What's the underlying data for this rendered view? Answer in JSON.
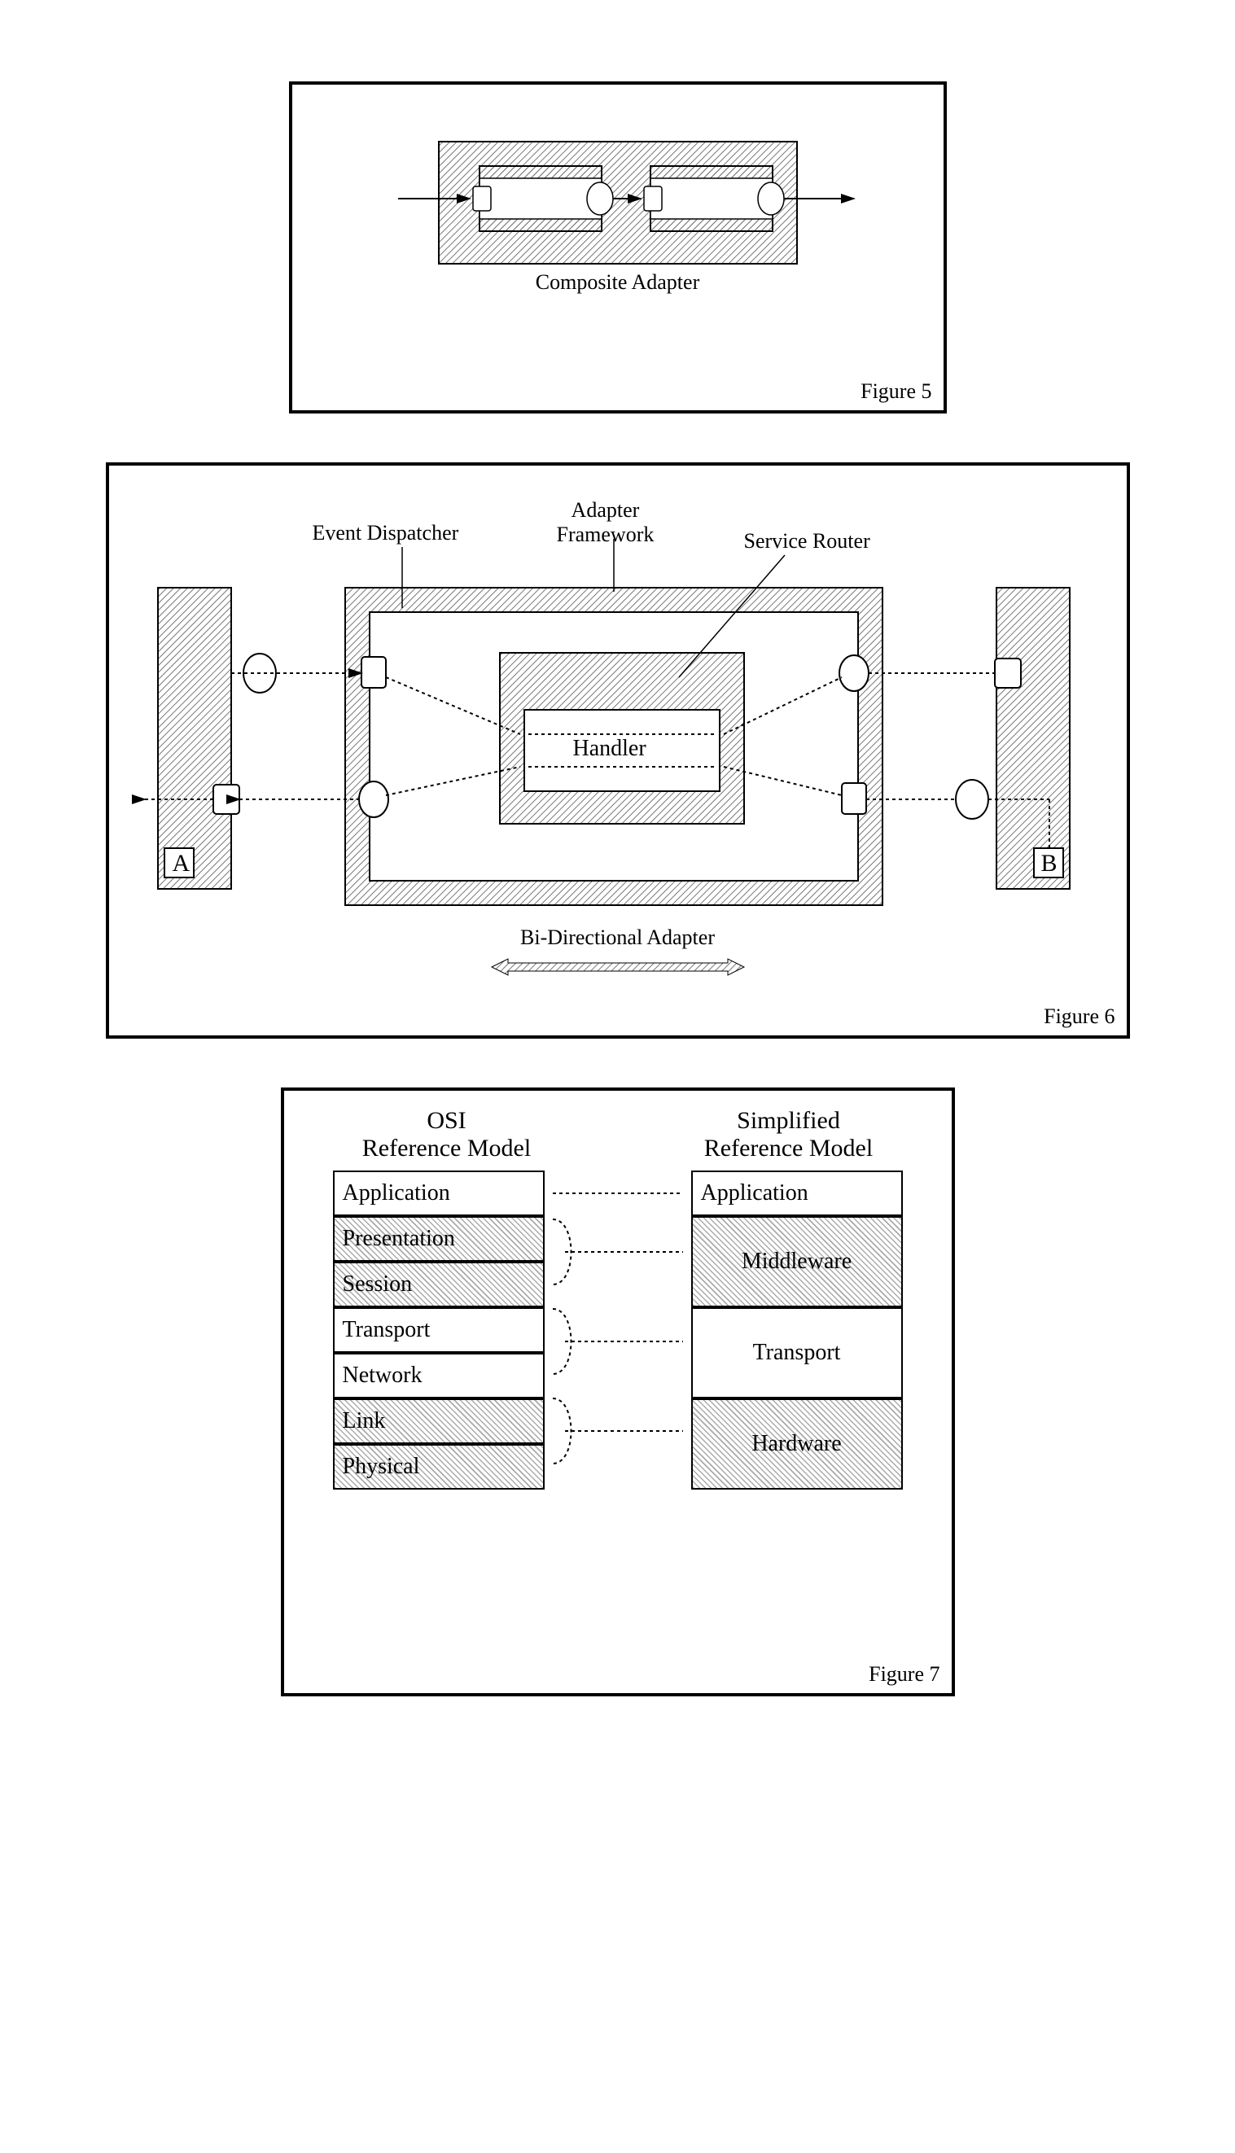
{
  "fig5": {
    "label": "Figure 5",
    "caption": "Composite Adapter"
  },
  "fig6": {
    "label": "Figure 6",
    "caption": "Bi-Directional Adapter",
    "ed": "Event Dispatcher",
    "af": "Adapter\nFramework",
    "sr": "Service Router",
    "handler": "Handler",
    "a": "A",
    "b": "B"
  },
  "fig7": {
    "label": "Figure 7",
    "left_title": "OSI\nReference Model",
    "right_title": "Simplified\nReference Model",
    "osi": [
      "Application",
      "Presentation",
      "Session",
      "Transport",
      "Network",
      "Link",
      "Physical"
    ],
    "simplified": [
      "Application",
      "Middleware",
      "Transport",
      "Hardware"
    ]
  }
}
